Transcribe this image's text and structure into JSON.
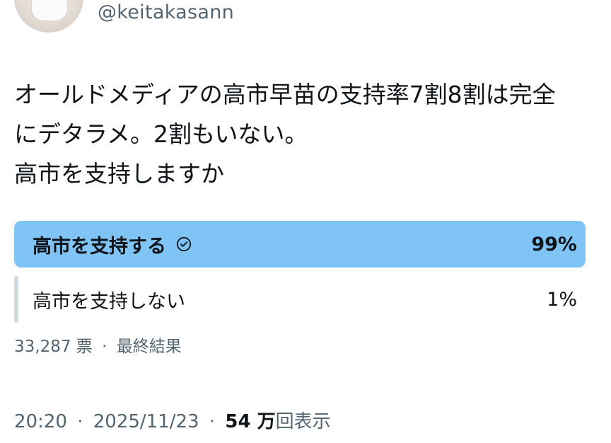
{
  "author": {
    "handle": "@keitakasann"
  },
  "tweet": {
    "lines": [
      "オールドメディアの高市早苗の支持率7割8割は完全",
      "にデタラメ。2割もいない。",
      "高市を支持しますか"
    ]
  },
  "poll": {
    "options": [
      {
        "label": "高市を支持する",
        "percent": 99,
        "percent_label": "99%",
        "selected": true
      },
      {
        "label": "高市を支持しない",
        "percent": 1,
        "percent_label": "1%",
        "selected": false
      }
    ],
    "votes": "33,287 票",
    "separator": "·",
    "status": "最終結果"
  },
  "meta": {
    "time": "20:20",
    "separator": "·",
    "date": "2025/11/23",
    "views_count": "54 万",
    "views_label": "回表示"
  },
  "colors": {
    "winner_fill": "#7fc4f5",
    "loser_fill": "#cfd9de",
    "text_primary": "#0f1419",
    "text_secondary": "#536471"
  },
  "icons": {
    "selected_option": "check-circle-icon"
  }
}
